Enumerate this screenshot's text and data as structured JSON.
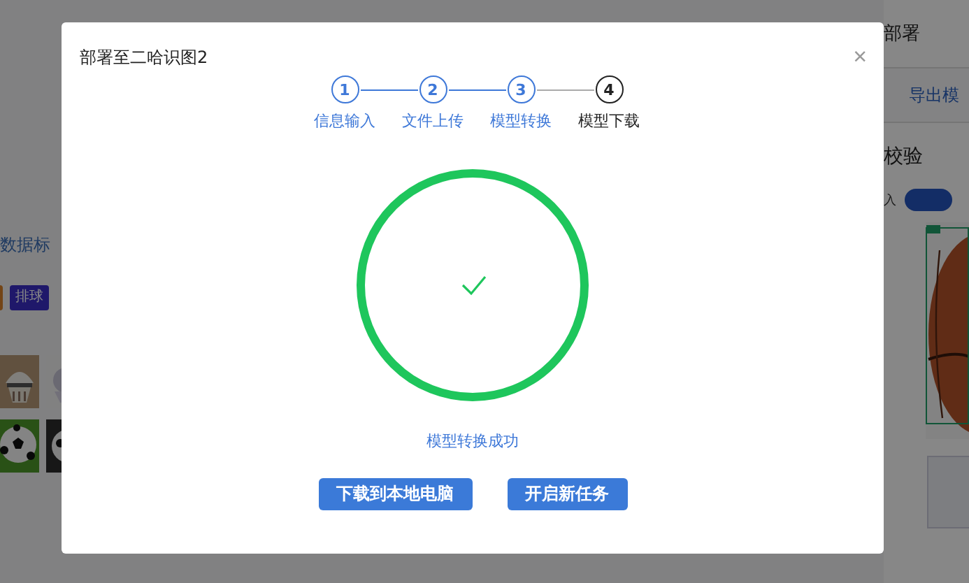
{
  "background": {
    "left": {
      "section_label": "数据标",
      "tags": [
        {
          "label": "排球"
        }
      ]
    },
    "right": {
      "title": "部署",
      "export_button": "导出模",
      "section_title": "校验",
      "switch_label": "入",
      "switch_on": true
    }
  },
  "dialog": {
    "title": "部署至二哈识图2",
    "close": "×",
    "steps": [
      {
        "number": "1",
        "label": "信息输入",
        "completed": true,
        "selected": false
      },
      {
        "number": "2",
        "label": "文件上传",
        "completed": true,
        "selected": false
      },
      {
        "number": "3",
        "label": "模型转换",
        "completed": true,
        "selected": false
      },
      {
        "number": "4",
        "label": "模型下载",
        "completed": false,
        "selected": true
      }
    ],
    "result": {
      "success": true,
      "message": "模型转换成功"
    },
    "buttons": [
      "下载到本地电脑",
      "开启新任务"
    ]
  }
}
